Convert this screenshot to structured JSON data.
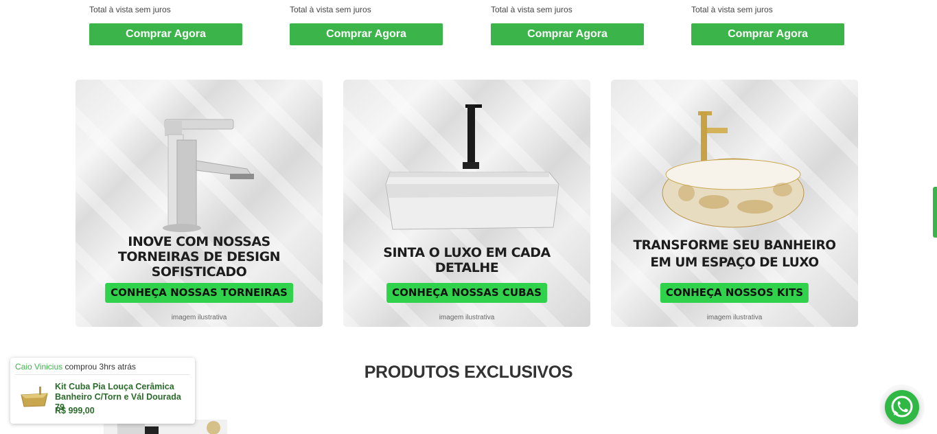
{
  "products": [
    {
      "payment_note": "Total à vista sem juros",
      "buy_label": "Comprar Agora"
    },
    {
      "payment_note": "Total à vista sem juros",
      "buy_label": "Comprar Agora"
    },
    {
      "payment_note": "Total à vista sem juros",
      "buy_label": "Comprar Agora"
    },
    {
      "payment_note": "Total à vista sem juros",
      "buy_label": "Comprar Agora"
    }
  ],
  "banners": [
    {
      "headline_lines": [
        "INOVE COM NOSSAS",
        "TORNEIRAS DE DESIGN",
        "SOFISTICADO"
      ],
      "cta": "CONHEÇA NOSSAS TORNEIRAS",
      "note": "imagem ilustrativa"
    },
    {
      "headline_lines": [
        "SINTA O LUXO EM CADA",
        "DETALHE"
      ],
      "cta": "CONHEÇA NOSSAS CUBAS",
      "note": "imagem ilustrativa"
    },
    {
      "headline_lines": [
        "TRANSFORME SEU BANHEIRO",
        "EM UM ESPAÇO DE LUXO"
      ],
      "cta": "CONHEÇA NOSSOS KITS",
      "note": "imagem ilustrativa"
    }
  ],
  "section_title": "PRODUTOS EXCLUSIVOS",
  "purchase_popup": {
    "buyer": "Caio Vinicius",
    "action": "comprou 3hrs atrás",
    "product_name": "Kit Cuba Pia Louça Cerâmica Banheiro C/Torn e Vál Dourada 79",
    "price": "R$ 999,00"
  },
  "icons": {
    "whatsapp": "whatsapp-icon"
  },
  "colors": {
    "buy_green": "#3bb54a",
    "cta_green": "#2fd24a",
    "whatsapp_green": "#2fb944"
  }
}
